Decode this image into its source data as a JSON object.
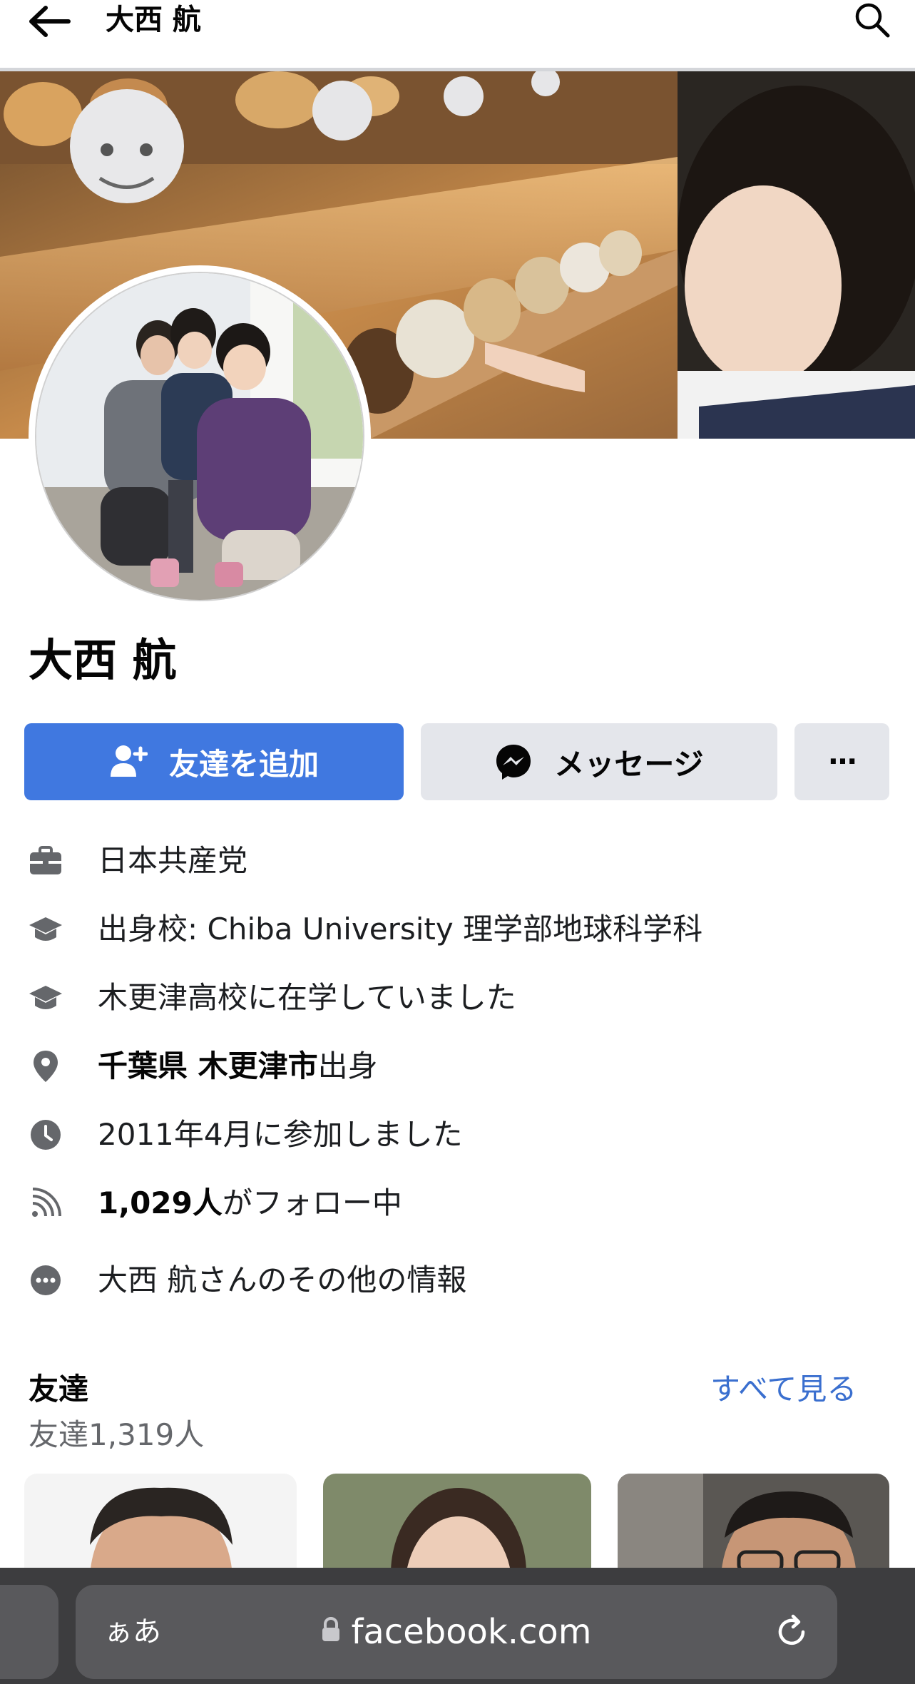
{
  "header": {
    "title": "大西 航",
    "back_icon": "arrow-left-icon",
    "search_icon": "search-icon"
  },
  "profile": {
    "name": "大西 航"
  },
  "actions": {
    "add_friend_label": "友達を追加",
    "message_label": "メッセージ",
    "more_label": "···",
    "add_friend_color": "#4078e0"
  },
  "info": {
    "work": "日本共産党",
    "education_prefix": "出身校: ",
    "education_value": "Chiba University 理学部地球科学科",
    "highschool": "木更津高校に在学していました",
    "hometown_bold": "千葉県 木更津市",
    "hometown_suffix": "出身",
    "joined": "2011年4月に参加しました",
    "followers_bold": "1,029人",
    "followers_suffix": "がフォロー中",
    "more_info": "大西 航さんのその他の情報"
  },
  "friends": {
    "title": "友達",
    "see_all": "すべて見る",
    "count": "友達1,319人"
  },
  "browser": {
    "aa": "ぁあ",
    "url": "facebook.com"
  }
}
